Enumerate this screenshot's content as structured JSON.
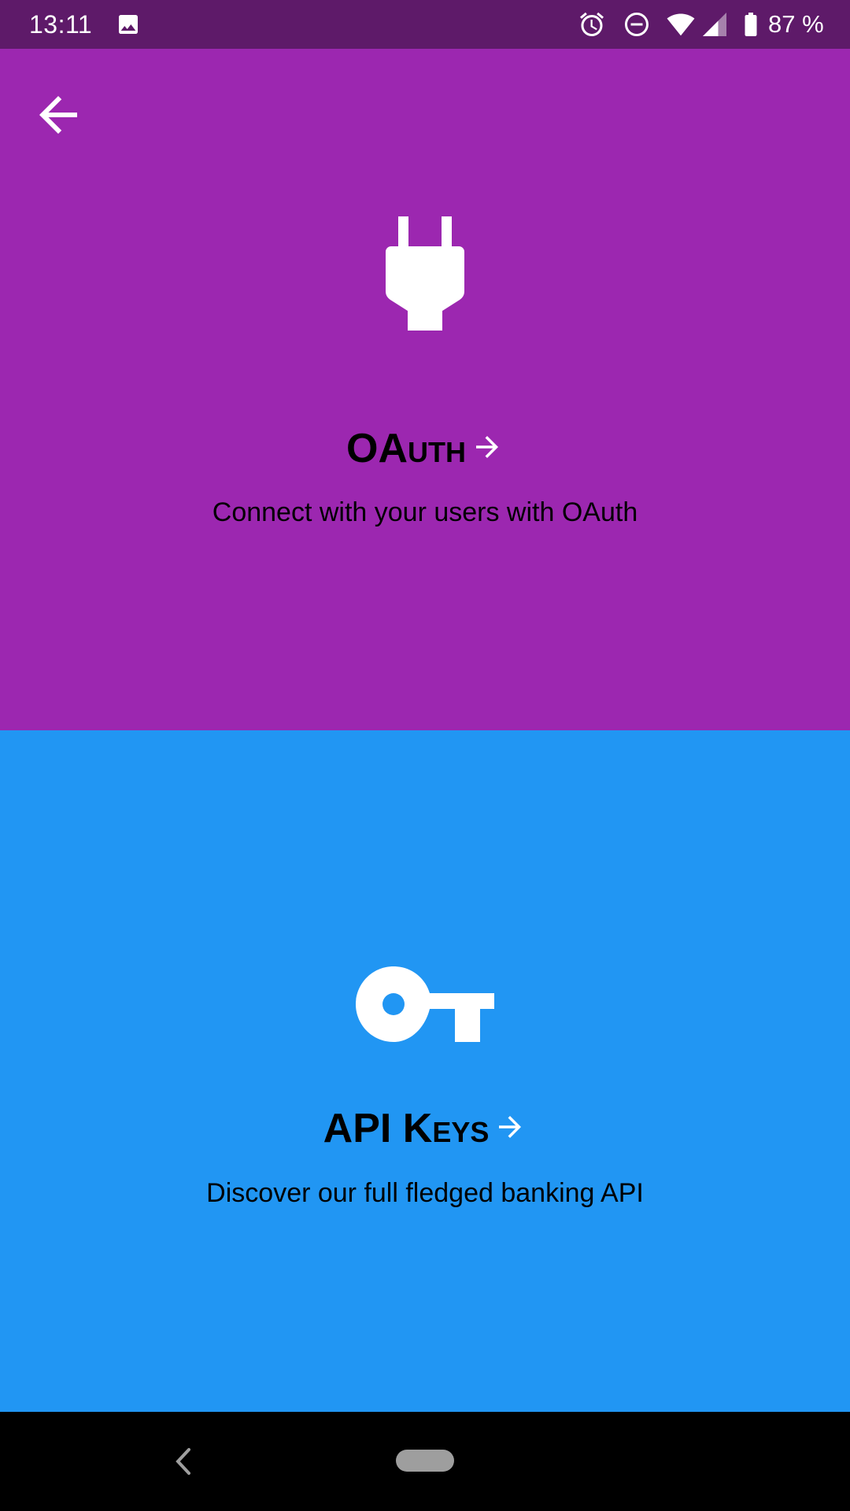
{
  "status_bar": {
    "time": "13:11",
    "battery_text": "87 %",
    "icons": [
      "image-icon",
      "alarm-icon",
      "do-not-disturb-icon",
      "wifi-icon",
      "signal-icon",
      "battery-icon"
    ],
    "background": "#5e1a69"
  },
  "header": {
    "back_icon": "arrow-back-icon"
  },
  "oauth": {
    "icon": "plug-icon",
    "title": "OAuth",
    "description": "Connect with your users with OAuth",
    "background": "#9c27b0"
  },
  "api_keys": {
    "icon": "key-icon",
    "title": "API Keys",
    "description": "Discover our full fledged banking API",
    "background": "#2196f3"
  },
  "nav_bar": {
    "icons": [
      "nav-back-icon",
      "home-pill-icon"
    ]
  }
}
